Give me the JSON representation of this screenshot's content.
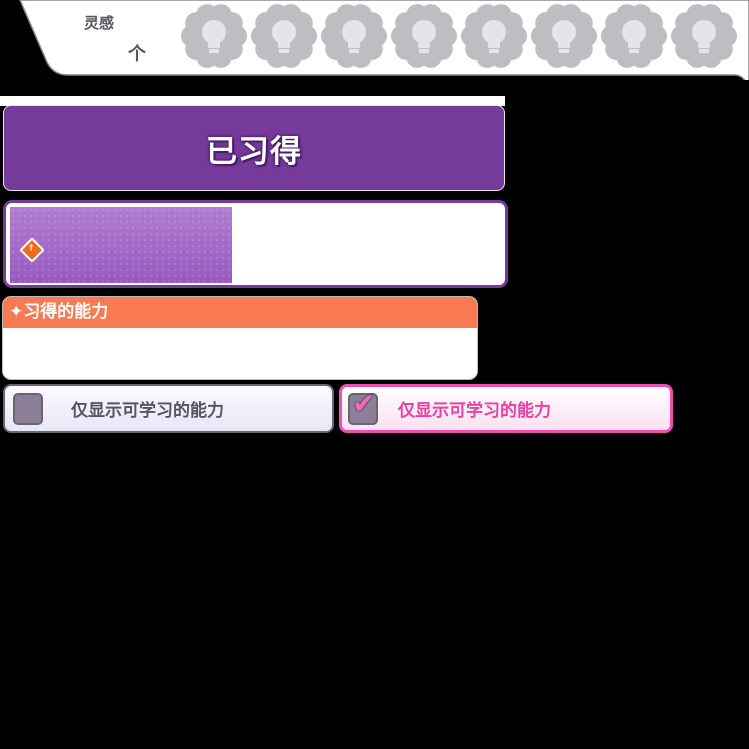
{
  "inspiration": {
    "label": "灵感",
    "arrow": "个",
    "bulb_count": 8,
    "bulb_color": "#c0bdc2"
  },
  "learned": {
    "title": "已习得",
    "progress_fill_percent": 45,
    "accent": "#763a9a"
  },
  "skills_panel": {
    "header": "✦习得的能力",
    "header_color": "#f97a52"
  },
  "filters": [
    {
      "label": "仅显示可学习的能力",
      "checked": false
    },
    {
      "label": "仅显示可学习的能力",
      "checked": true
    }
  ]
}
